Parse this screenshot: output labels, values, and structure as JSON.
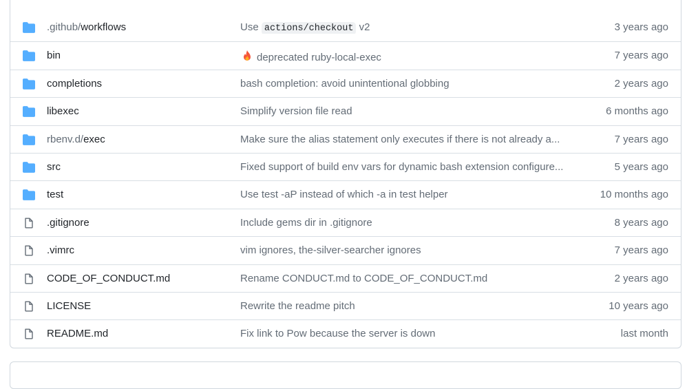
{
  "files": [
    {
      "type": "dir",
      "name_dim": ".github/",
      "name": "workflows",
      "msg_before": "Use ",
      "msg_code": "actions/checkout",
      "msg_after": " v2",
      "age": "3 years ago"
    },
    {
      "type": "dir",
      "name_dim": "",
      "name": "bin",
      "msg_emoji": "fire-icon",
      "msg": "deprecated ruby-local-exec",
      "age": "7 years ago"
    },
    {
      "type": "dir",
      "name_dim": "",
      "name": "completions",
      "msg": "bash completion: avoid unintentional globbing",
      "age": "2 years ago"
    },
    {
      "type": "dir",
      "name_dim": "",
      "name": "libexec",
      "msg": "Simplify version file read",
      "age": "6 months ago"
    },
    {
      "type": "dir",
      "name_dim": "rbenv.d/",
      "name": "exec",
      "msg": "Make sure the alias statement only executes if there is not already a...",
      "age": "7 years ago"
    },
    {
      "type": "dir",
      "name_dim": "",
      "name": "src",
      "msg": "Fixed support of build env vars for dynamic bash extension configure...",
      "age": "5 years ago"
    },
    {
      "type": "dir",
      "name_dim": "",
      "name": "test",
      "msg": "Use test -aP instead of which -a in test helper",
      "age": "10 months ago"
    },
    {
      "type": "file",
      "name_dim": "",
      "name": ".gitignore",
      "msg": "Include gems dir in .gitignore",
      "age": "8 years ago"
    },
    {
      "type": "file",
      "name_dim": "",
      "name": ".vimrc",
      "msg": "vim ignores, the-silver-searcher ignores",
      "age": "7 years ago"
    },
    {
      "type": "file",
      "name_dim": "",
      "name": "CODE_OF_CONDUCT.md",
      "msg": "Rename CONDUCT.md to CODE_OF_CONDUCT.md",
      "age": "2 years ago"
    },
    {
      "type": "file",
      "name_dim": "",
      "name": "LICENSE",
      "msg": "Rewrite the readme pitch",
      "age": "10 years ago"
    },
    {
      "type": "file",
      "name_dim": "",
      "name": "README.md",
      "msg": "Fix link to Pow because the server is down",
      "age": "last month"
    }
  ],
  "colors": {
    "folder": "#54aeff",
    "file_icon": "#636c76",
    "border": "#d0d7de",
    "muted_text": "#636c76",
    "fire": "#f5563a"
  }
}
